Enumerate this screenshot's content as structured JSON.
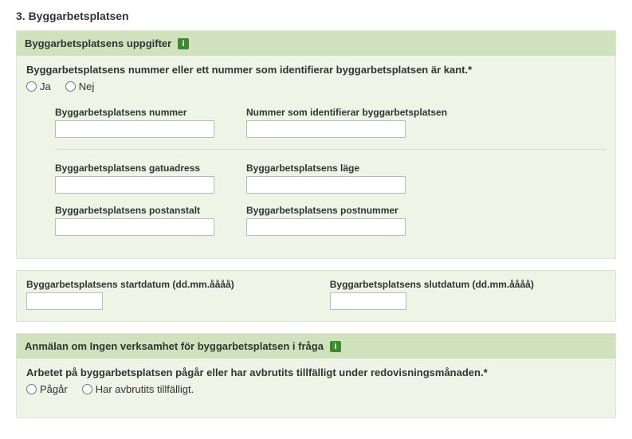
{
  "section": {
    "title": "3. Byggarbetsplatsen"
  },
  "panel1": {
    "heading": "Byggarbetsplatsens uppgifter",
    "question": "Byggarbetsplatsens nummer eller ett nummer som identifierar byggarbetsplatsen är kant.*",
    "radio_yes": "Ja",
    "radio_no": "Nej",
    "field_number": "Byggarbetsplatsens nummer",
    "field_idnumber": "Nummer som identifierar byggarbetsplatsen",
    "field_street": "Byggarbetsplatsens gatuadress",
    "field_location": "Byggarbetsplatsens läge",
    "field_postoffice": "Byggarbetsplatsens postanstalt",
    "field_postnumber": "Byggarbetsplatsens postnummer",
    "field_startdate": "Byggarbetsplatsens startdatum (dd.mm.åååå)",
    "field_enddate": "Byggarbetsplatsens slutdatum (dd.mm.åååå)"
  },
  "panel2": {
    "heading": "Anmälan om Ingen verksamhet för byggarbetsplatsen i fråga",
    "question": "Arbetet på byggarbetsplatsen pågår eller har avbrutits tillfälligt under redovisningsmånaden.*",
    "radio_ongoing": "Pågår",
    "radio_paused": "Har avbrutits tillfälligt."
  }
}
